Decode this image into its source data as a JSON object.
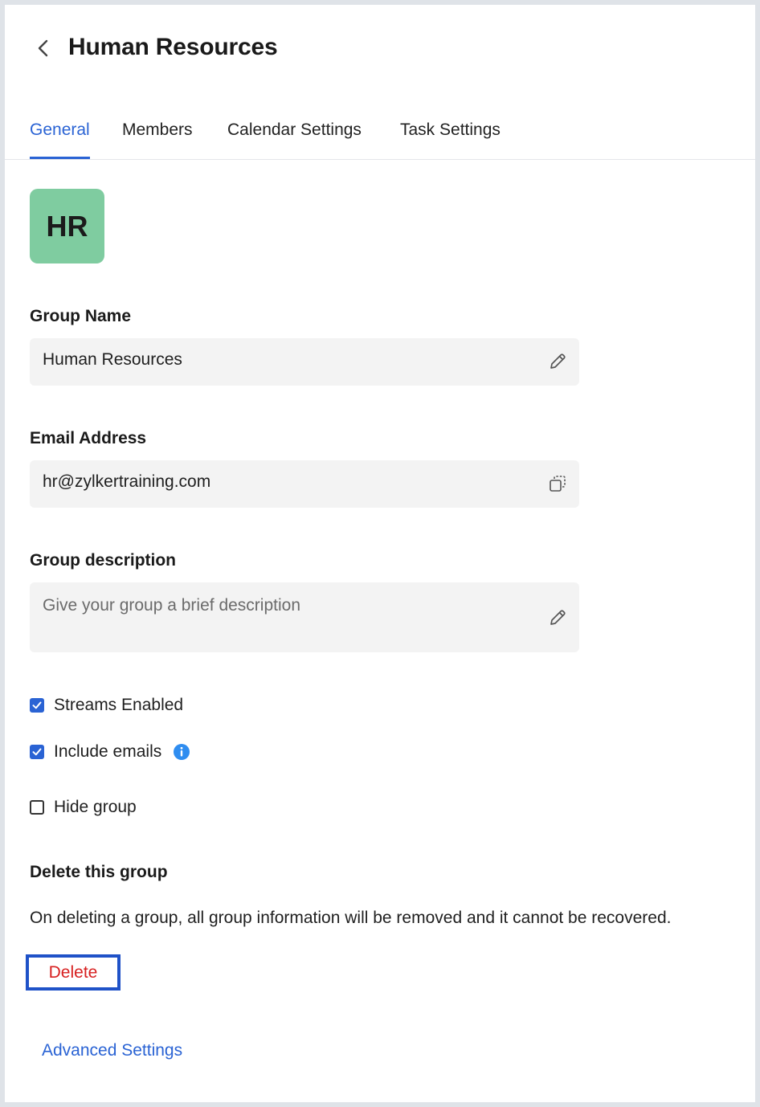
{
  "header": {
    "back_icon": "chevron-left-icon",
    "title": "Human Resources"
  },
  "tabs": [
    {
      "label": "General",
      "active": true
    },
    {
      "label": "Members",
      "active": false
    },
    {
      "label": "Calendar Settings",
      "active": false
    },
    {
      "label": "Task Settings",
      "active": false
    }
  ],
  "avatar": {
    "initials": "HR",
    "color": "#7fcca0"
  },
  "group_name": {
    "label": "Group Name",
    "value": "Human Resources",
    "icon": "pencil-icon"
  },
  "email": {
    "label": "Email Address",
    "value": "hr@zylkertraining.com",
    "icon": "copy-icon"
  },
  "description": {
    "label": "Group description",
    "placeholder": "Give your group a brief description",
    "icon": "pencil-icon"
  },
  "options": [
    {
      "label": "Streams Enabled",
      "checked": true
    },
    {
      "label": "Include emails",
      "checked": true,
      "info_icon": "info-icon"
    },
    {
      "label": "Hide group",
      "checked": false
    }
  ],
  "delete_section": {
    "heading": "Delete this group",
    "text": "On deleting a group, all group information will be removed and it cannot be recovered.",
    "button_label": "Delete"
  },
  "advanced_link": "Advanced Settings",
  "colors": {
    "accent": "#2a63d4",
    "danger": "#d71f1f",
    "focus_outline": "#1f52c8"
  }
}
